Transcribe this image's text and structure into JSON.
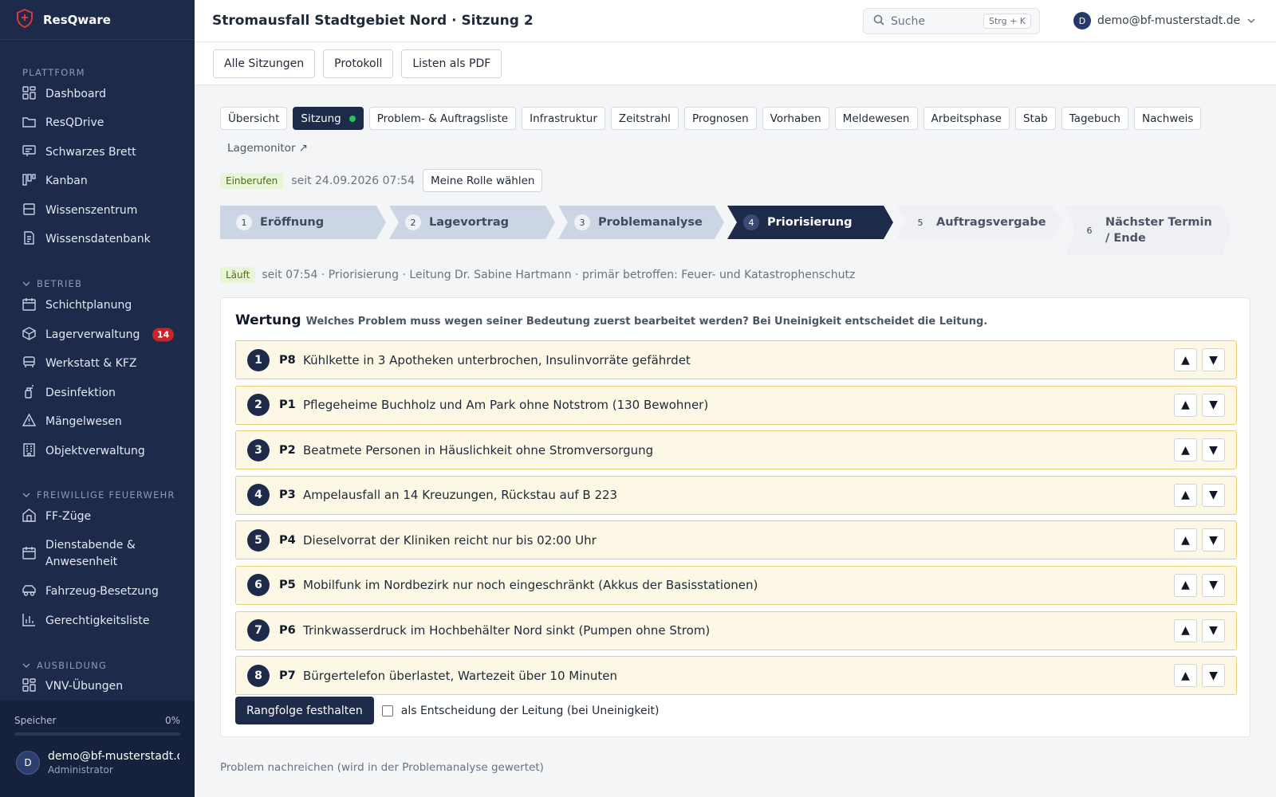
{
  "brand": {
    "name": "ResQware"
  },
  "sidebar": {
    "sections": [
      {
        "title": "PLATTFORM",
        "items": [
          {
            "label": "Dashboard",
            "icon": "dashboard-icon"
          },
          {
            "label": "ResQDrive",
            "icon": "folder-icon"
          },
          {
            "label": "Schwarzes Brett",
            "icon": "board-icon"
          },
          {
            "label": "Kanban",
            "icon": "kanban-icon"
          },
          {
            "label": "Wissenszentrum",
            "icon": "knowledge-icon"
          },
          {
            "label": "Wissensdatenbank",
            "icon": "document-icon"
          }
        ]
      },
      {
        "title": "BETRIEB",
        "items": [
          {
            "label": "Schichtplanung",
            "icon": "calendar-icon"
          },
          {
            "label": "Lagerverwaltung",
            "icon": "box-icon",
            "badge": "14"
          },
          {
            "label": "Werkstatt & KFZ",
            "icon": "car-icon"
          },
          {
            "label": "Desinfektion",
            "icon": "spray-icon"
          },
          {
            "label": "Mängelwesen",
            "icon": "warning-icon"
          },
          {
            "label": "Objektverwaltung",
            "icon": "building-icon"
          }
        ]
      },
      {
        "title": "FREIWILLIGE FEUERWEHR",
        "items": [
          {
            "label": "FF-Züge",
            "icon": "station-icon"
          },
          {
            "label": "Dienstabende & Anwesenheit",
            "icon": "calendar-icon"
          },
          {
            "label": "Fahrzeug-Besetzung",
            "icon": "vehicle-icon"
          },
          {
            "label": "Gerechtigkeitsliste",
            "icon": "chart-icon"
          }
        ]
      },
      {
        "title": "AUSBILDUNG",
        "items": [
          {
            "label": "VNV-Übungen",
            "icon": "dashboard-icon"
          }
        ]
      }
    ],
    "storage": {
      "label": "Speicher",
      "value": "0%"
    },
    "user": {
      "initial": "D",
      "name": "demo@bf-musterstadt.de",
      "role": "Administrator"
    }
  },
  "header": {
    "title": "Stromausfall Stadtgebiet Nord · Sitzung 2",
    "search_placeholder": "Suche",
    "search_shortcut": "Strg + K",
    "account_initial": "D",
    "account_email": "demo@bf-musterstadt.de"
  },
  "actions": [
    "Alle Sitzungen",
    "Protokoll",
    "Listen als PDF"
  ],
  "tabs": [
    "Übersicht",
    "Sitzung",
    "Problem- & Auftragsliste",
    "Infrastruktur",
    "Zeitstrahl",
    "Prognosen",
    "Vorhaben",
    "Meldewesen",
    "Arbeitsphase",
    "Stab",
    "Tagebuch",
    "Nachweis"
  ],
  "tab_external": "Lagemonitor ↗",
  "status": {
    "pill": "Einberufen",
    "since": "seit 24.09.2026 07:54",
    "role_button": "Meine Rolle wählen"
  },
  "steps": [
    {
      "num": "1",
      "label": "Eröffnung"
    },
    {
      "num": "2",
      "label": "Lagevortrag"
    },
    {
      "num": "3",
      "label": "Problemanalyse"
    },
    {
      "num": "4",
      "label": "Priorisierung"
    },
    {
      "num": "5",
      "label": "Auftragsvergabe"
    },
    {
      "num": "6",
      "label": "Nächster Termin / Ende"
    }
  ],
  "running": {
    "pill": "Läuft",
    "text": "seit 07:54 · Priorisierung · Leitung Dr. Sabine Hartmann · primär betroffen: Feuer- und Katastrophenschutz"
  },
  "rating": {
    "title": "Wertung",
    "subtitle": "Welches Problem muss wegen seiner Bedeutung zuerst bearbeitet werden? Bei Uneinigkeit entscheidet die Leitung.",
    "items": [
      {
        "rank": "1",
        "id": "P8",
        "text": "Kühlkette in 3 Apotheken unterbrochen, Insulinvorräte gefährdet"
      },
      {
        "rank": "2",
        "id": "P1",
        "text": "Pflegeheime Buchholz und Am Park ohne Notstrom (130 Bewohner)"
      },
      {
        "rank": "3",
        "id": "P2",
        "text": "Beatmete Personen in Häuslichkeit ohne Stromversorgung"
      },
      {
        "rank": "4",
        "id": "P3",
        "text": "Ampelausfall an 14 Kreuzungen, Rückstau auf B 223"
      },
      {
        "rank": "5",
        "id": "P4",
        "text": "Dieselvorrat der Kliniken reicht nur bis 02:00 Uhr"
      },
      {
        "rank": "6",
        "id": "P5",
        "text": "Mobilfunk im Nordbezirk nur noch eingeschränkt (Akkus der Basisstationen)"
      },
      {
        "rank": "7",
        "id": "P6",
        "text": "Trinkwasserdruck im Hochbehälter Nord sinkt (Pumpen ohne Strom)"
      },
      {
        "rank": "8",
        "id": "P7",
        "text": "Bürgertelefon überlastet, Wartezeit über 10 Minuten"
      }
    ],
    "commit_label": "Rangfolge festhalten",
    "checkbox_label": "als Entscheidung der Leitung (bei Uneinigkeit)"
  },
  "footer_note": "Problem nachreichen (wird in der Problemanalyse gewertet)"
}
